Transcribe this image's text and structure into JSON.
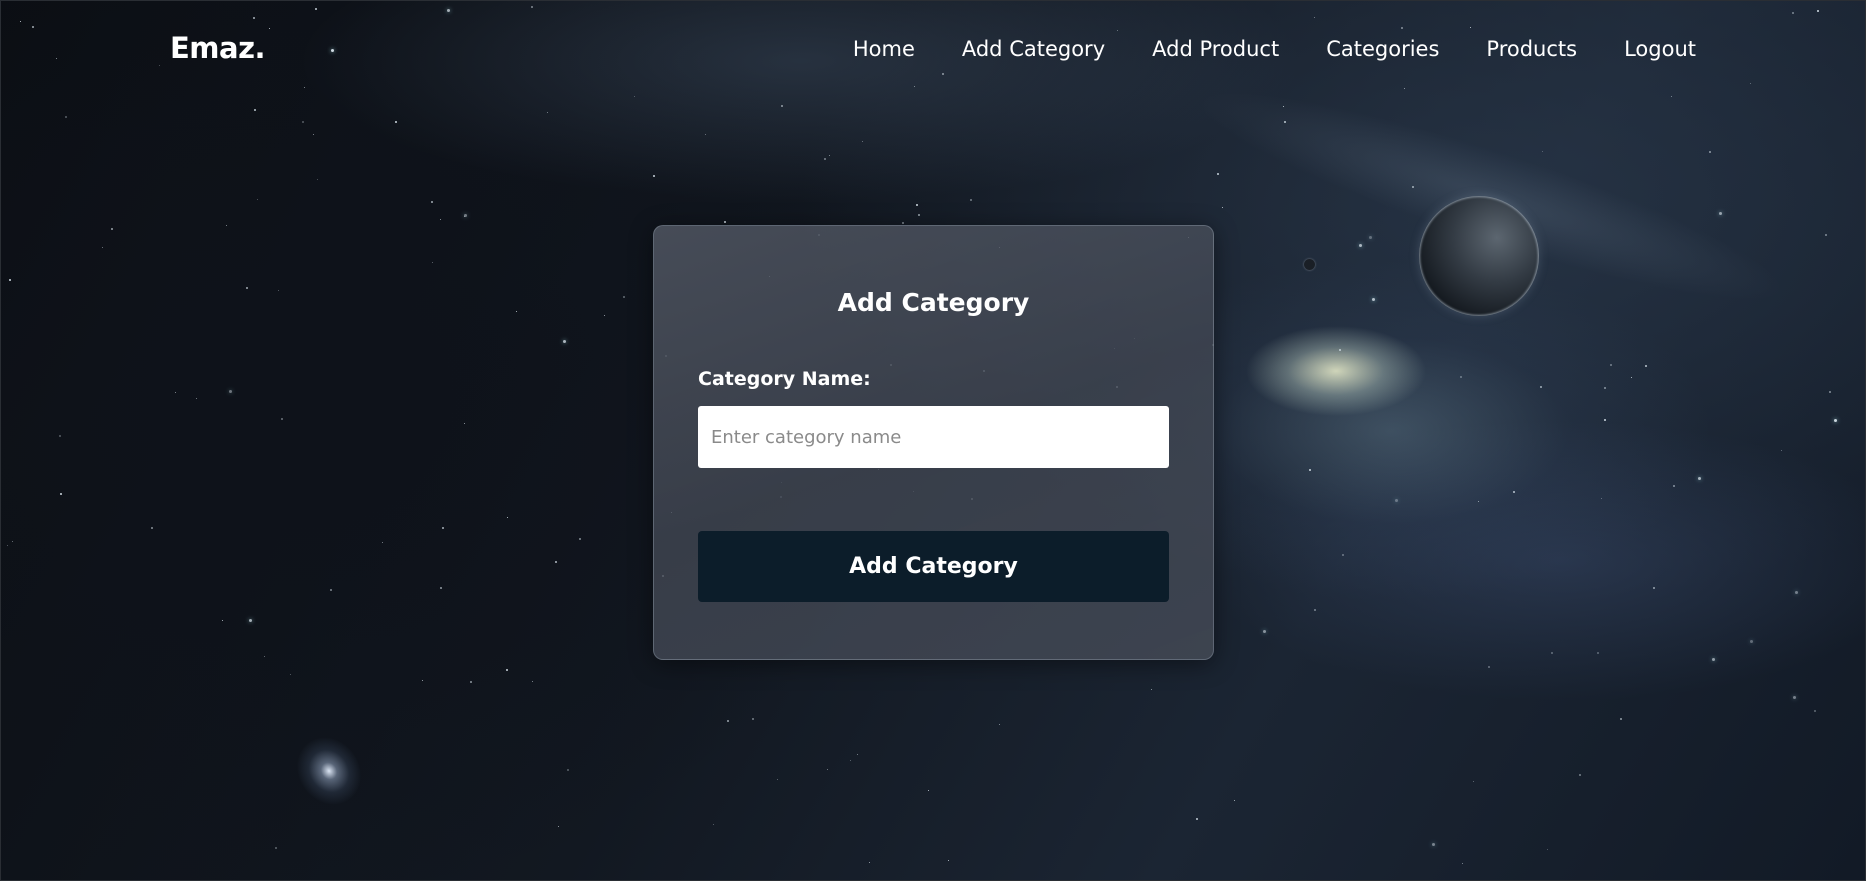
{
  "brand": {
    "name": "Emaz."
  },
  "nav": {
    "items": [
      {
        "label": "Home"
      },
      {
        "label": "Add Category"
      },
      {
        "label": "Add Product"
      },
      {
        "label": "Categories"
      },
      {
        "label": "Products"
      },
      {
        "label": "Logout"
      }
    ]
  },
  "form": {
    "title": "Add Category",
    "field_label": "Category Name:",
    "input_value": "",
    "input_placeholder": "Enter category name",
    "submit_label": "Add Category"
  },
  "colors": {
    "card_background": "#4a505c",
    "button_background": "#0c1d2a",
    "text": "#ffffff",
    "input_background": "#ffffff"
  }
}
